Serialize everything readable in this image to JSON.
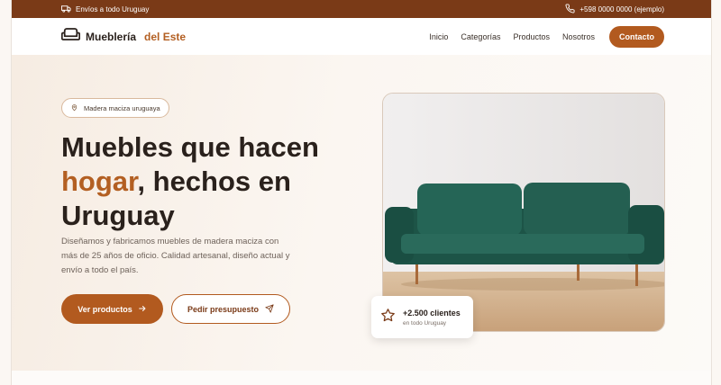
{
  "topbar": {
    "shipping_text": "Envíos a todo Uruguay",
    "phone_text": "+598 0000 0000 (ejemplo)",
    "truck_icon": "truck-icon",
    "phone_icon": "phone-icon"
  },
  "header": {
    "brand_name": "Mueblería",
    "brand_accent": "del Este",
    "logo_icon": "sofa-icon",
    "nav": [
      {
        "label": "Inicio"
      },
      {
        "label": "Categorías"
      },
      {
        "label": "Productos"
      },
      {
        "label": "Nosotros"
      }
    ],
    "contact_label": "Contacto"
  },
  "hero": {
    "badge_text": "Madera maciza uruguaya",
    "badge_icon": "pin-icon",
    "headline_part1": "Muebles que hacen",
    "headline_accent": "hogar",
    "headline_part2": ", hechos en Uruguay",
    "description": "Diseñamos y fabricamos muebles de madera maciza con más de 25 años de oficio. Calidad artesanal, diseño actual y envío a todo el país.",
    "primary_button": "Ver productos",
    "secondary_button": "Pedir presupuesto",
    "stat_value": "+2.500 clientes",
    "stat_sub": "en todo Uruguay",
    "stat_icon": "star-icon"
  },
  "colors": {
    "brand": "#b25a1f",
    "topbar": "#7a3a17",
    "text_dark": "#2a211c",
    "sofa": "#1f5a4c"
  }
}
